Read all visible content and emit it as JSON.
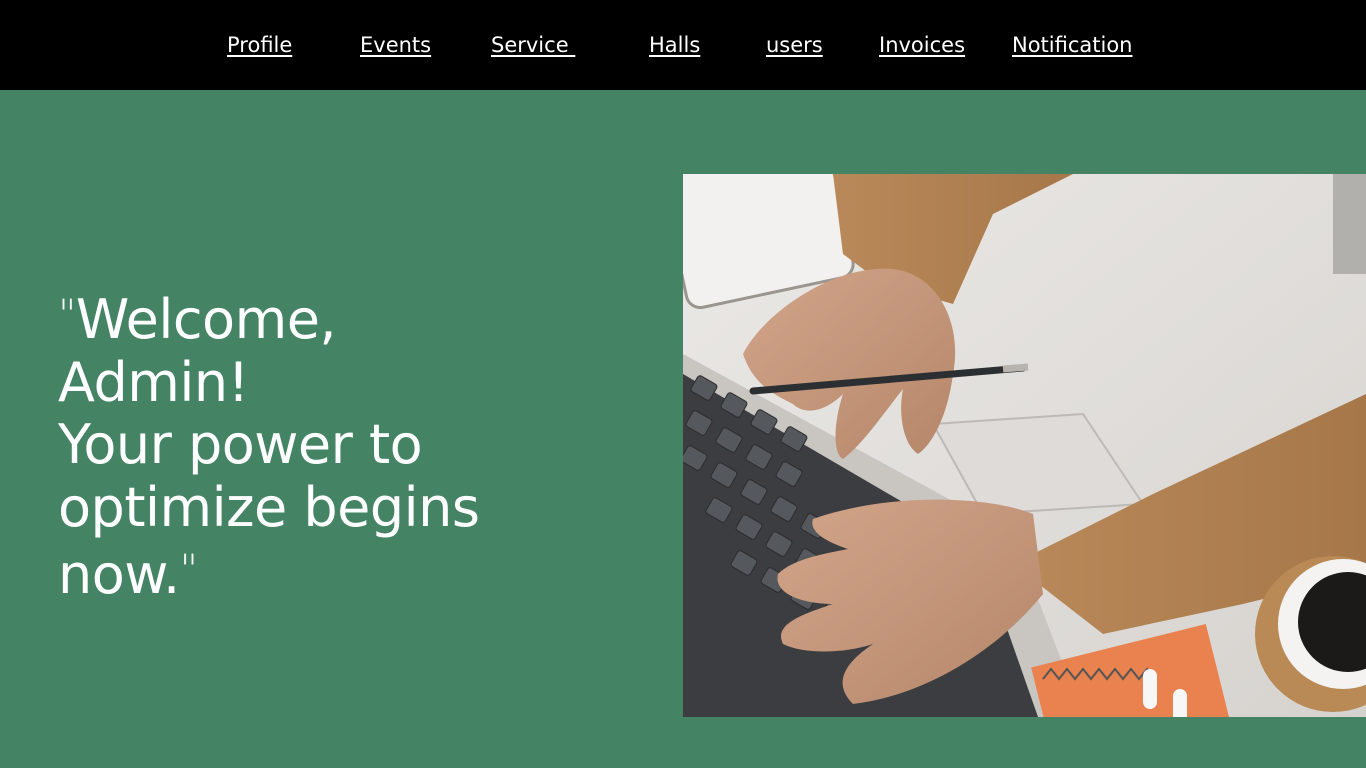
{
  "nav": {
    "items": [
      {
        "label": "Profile"
      },
      {
        "label": "Events"
      },
      {
        "label": "Service "
      },
      {
        "label": "Halls"
      },
      {
        "label": "users"
      },
      {
        "label": "Invoices"
      },
      {
        "label": "Notification"
      }
    ]
  },
  "hero": {
    "open_quote": "\"",
    "line1": "Welcome,",
    "line2": "Admin!",
    "line3": "Your power to",
    "line4": "optimize begins",
    "line5": "now.",
    "close_quote": "\""
  },
  "colors": {
    "navbar": "#000000",
    "background": "#448465",
    "text": "#ffffff"
  }
}
